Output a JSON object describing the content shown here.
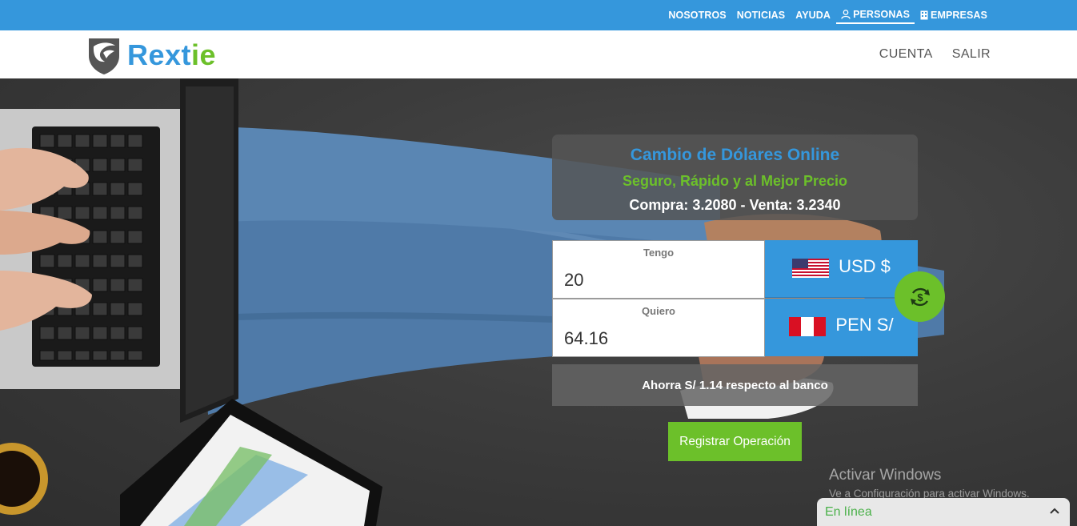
{
  "topnav": {
    "items": [
      {
        "label": "NOSOTROS"
      },
      {
        "label": "NOTICIAS"
      },
      {
        "label": "AYUDA"
      },
      {
        "label": "PERSONAS"
      },
      {
        "label": "EMPRESAS"
      }
    ]
  },
  "brand": {
    "name_main": "Rext",
    "name_accent": "ie",
    "primary_color": "#3597dc",
    "accent_color": "#6cc02a"
  },
  "mainnav": {
    "account": "CUENTA",
    "logout": "SALIR"
  },
  "hero": {
    "title": "Cambio de Dólares Online",
    "subtitle": "Seguro, Rápido y al Mejor Precio",
    "rates": "Compra: 3.2080  -  Venta: 3.2340"
  },
  "converter": {
    "have_label": "Tengo",
    "have_value": "20",
    "have_currency": "USD $",
    "want_label": "Quiero",
    "want_value": "64.16",
    "want_currency": "PEN S/",
    "savings": "Ahorra S/ 1.14 respecto al banco",
    "register_button": "Registrar Operación"
  },
  "windows_watermark": {
    "title": "Activar Windows",
    "subtitle": "Ve a Configuración para activar Windows."
  },
  "chat": {
    "status": "En línea"
  }
}
